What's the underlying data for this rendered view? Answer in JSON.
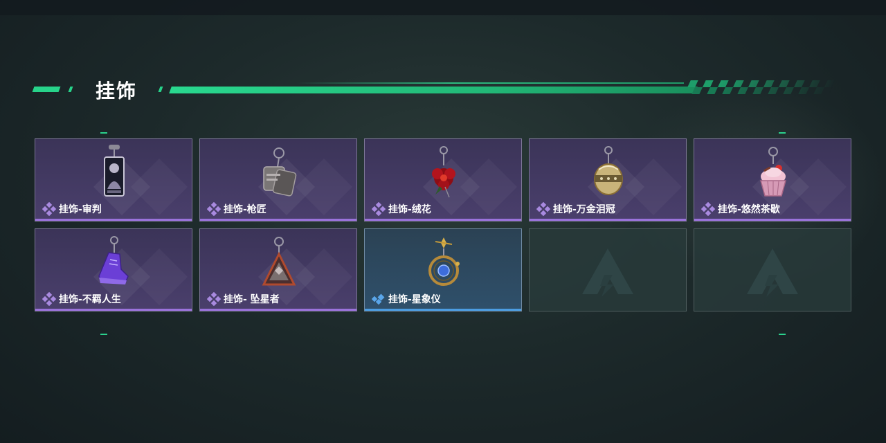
{
  "section": {
    "title": "挂饰"
  },
  "colors": {
    "accent": "#27d38a",
    "rarity_purple": "#9b73dc",
    "rarity_blue": "#4c9de2"
  },
  "items": [
    {
      "label": "挂饰-审判",
      "rarity": "purple",
      "icon": "tarot-card-charm-icon"
    },
    {
      "label": "挂饰-枪匠",
      "rarity": "purple",
      "icon": "dog-tag-charm-icon"
    },
    {
      "label": "挂饰-绒花",
      "rarity": "purple",
      "icon": "velvet-flower-charm-icon"
    },
    {
      "label": "挂饰-万金泪冠",
      "rarity": "purple",
      "icon": "jeweled-crown-charm-icon"
    },
    {
      "label": "挂饰-悠然茶歇",
      "rarity": "purple",
      "icon": "cupcake-charm-icon"
    },
    {
      "label": "挂饰-不羁人生",
      "rarity": "purple",
      "icon": "sneaker-charm-icon"
    },
    {
      "label": "挂饰- 坠星者",
      "rarity": "purple",
      "icon": "triangle-emblem-charm-icon"
    },
    {
      "label": "挂饰-星象仪",
      "rarity": "blue",
      "icon": "astrolabe-charm-icon"
    },
    {
      "label": "",
      "rarity": "empty",
      "icon": "empty-slot-logo-icon"
    },
    {
      "label": "",
      "rarity": "empty",
      "icon": "empty-slot-logo-icon"
    }
  ]
}
